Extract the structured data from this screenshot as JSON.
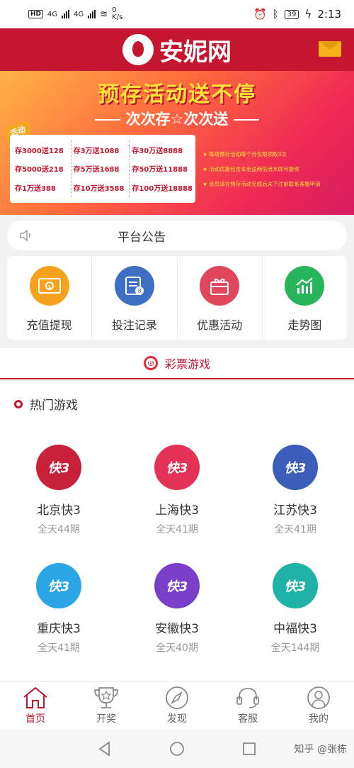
{
  "status_bar": {
    "network_label": "HD",
    "net1": "4G",
    "net2": "4G",
    "speed_value": "0",
    "speed_unit": "K/s",
    "battery": "39",
    "time": "2:13"
  },
  "header": {
    "logo_text": "安妮网"
  },
  "banner": {
    "title": "预存活动送不停",
    "subtitle": "次次存☆次次送",
    "tag": "活动",
    "columns": [
      [
        "存3000送128",
        "存5000送218",
        "存1万送388"
      ],
      [
        "存3万送1088",
        "存5万送1688",
        "存10万送3588"
      ],
      [
        "存30万送8888",
        "存50万送11888",
        "存100万送18888"
      ]
    ],
    "notes": [
      "★ 每项预存活动每个月仅限领取3次",
      "★ 活动优惠包含本金送两倍流水即可提现",
      "★ 会员请在预存活动完成后未下注前联系客服申请"
    ]
  },
  "announcement": {
    "text": "平台公告"
  },
  "quick_menu": [
    {
      "label": "充值提现",
      "color": "#f6a21e",
      "icon": "money-icon"
    },
    {
      "label": "投注记录",
      "color": "#3d6fc4",
      "icon": "record-icon"
    },
    {
      "label": "优惠活动",
      "color": "#e0475a",
      "icon": "gift-icon"
    },
    {
      "label": "走势图",
      "color": "#27b45a",
      "icon": "trend-icon"
    }
  ],
  "section_tab": {
    "ball": "8",
    "title": "彩票游戏"
  },
  "hot_games": {
    "title": "热门游戏",
    "items": [
      {
        "name": "北京快3",
        "sub": "全天44期",
        "color": "#c8223a"
      },
      {
        "name": "上海快3",
        "sub": "全天41期",
        "color": "#e43156"
      },
      {
        "name": "江苏快3",
        "sub": "全天41期",
        "color": "#3b5fb8"
      },
      {
        "name": "重庆快3",
        "sub": "全天41期",
        "color": "#2aa6e6"
      },
      {
        "name": "安徽快3",
        "sub": "全天40期",
        "color": "#7a3fc8"
      },
      {
        "name": "中福快3",
        "sub": "全天144期",
        "color": "#1fb3a8"
      }
    ],
    "icon_text": "快3"
  },
  "bottom_nav": [
    {
      "label": "首页",
      "icon": "home-icon"
    },
    {
      "label": "开奖",
      "icon": "trophy-icon"
    },
    {
      "label": "发现",
      "icon": "compass-icon"
    },
    {
      "label": "客服",
      "icon": "headset-icon"
    },
    {
      "label": "我的",
      "icon": "user-icon"
    }
  ],
  "watermark": "知乎 @张栋",
  "colors": {
    "brand": "#c4172f",
    "accent_yellow": "#ffe23a"
  }
}
